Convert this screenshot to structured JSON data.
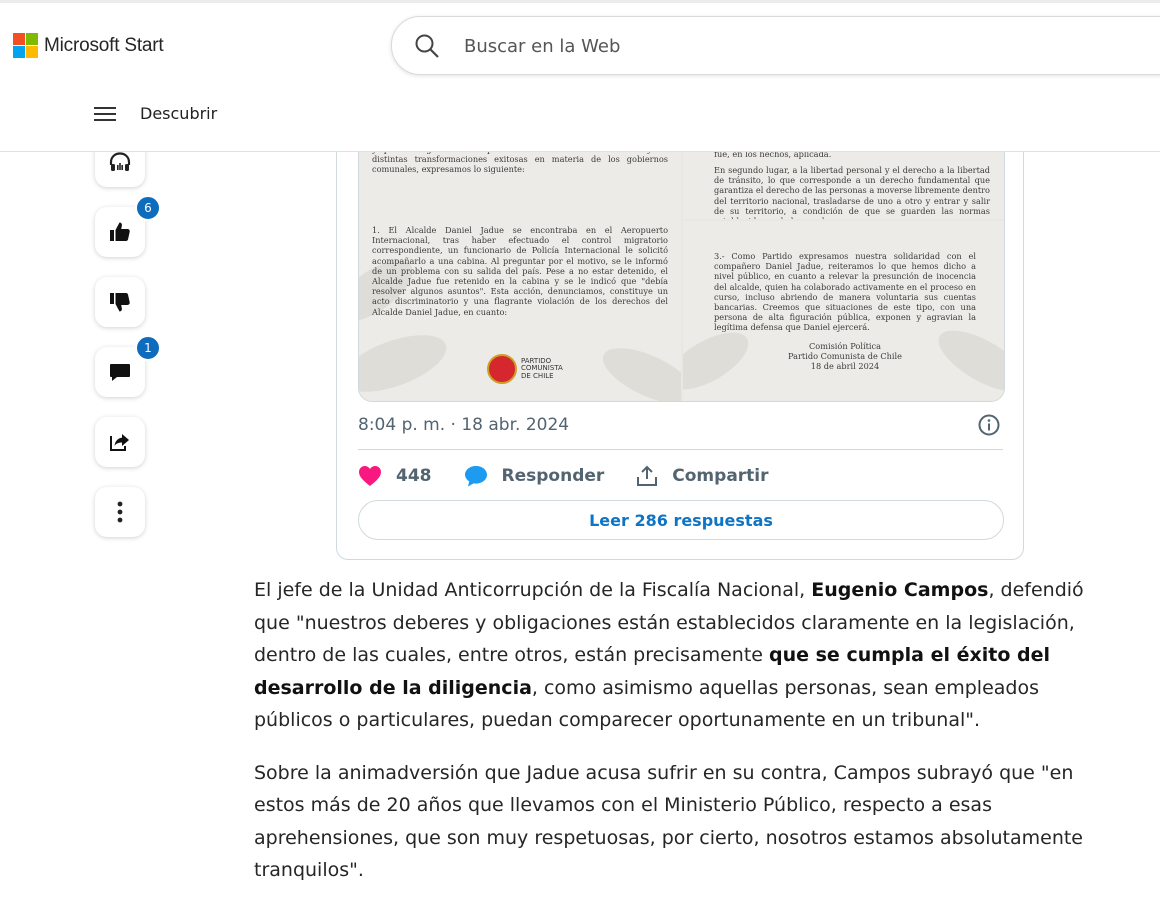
{
  "header": {
    "brand": "Microsoft Start",
    "search_placeholder": "Buscar en la Web",
    "nav_label": "Descubrir",
    "colors": {
      "ms_red": "#f25022",
      "ms_green": "#7fba00",
      "ms_blue": "#00a4ef",
      "ms_yellow": "#ffb900"
    }
  },
  "rail": {
    "buttons": [
      {
        "icon": "headphones-icon"
      },
      {
        "icon": "thumbs-up-icon",
        "badge": "6"
      },
      {
        "icon": "thumbs-down-icon"
      },
      {
        "icon": "comment-icon",
        "badge": "1"
      },
      {
        "icon": "share-icon"
      },
      {
        "icon": "more-icon"
      }
    ]
  },
  "tweet": {
    "doc_left_p1": "patente vulneración a sus derechos garantizados constitucionalmente, mientras se dirigía al \"Encuentro hacia la Agenda Alternativa Social Mundial\", invitación de la que tenía conocimiento la Comisión Política y que se origina en su experiencia como alcalde de Recoleta y las distintas transformaciones exitosas en materia de los gobiernos comunales, expresamos lo siguiente:",
    "doc_left_p2": "1. El Alcalde Daniel Jadue se encontraba en el Aeropuerto Internacional, tras haber efectuado el control migratorio correspondiente, un funcionario de Policía Internacional le solicitó acompañarlo a una cabina. Al preguntar por el motivo, se le informó de un problema con su salida del país. Pese a no estar detenido, el Alcalde Jadue fue retenido en la cabina y se le indicó que \"debía resolver algunos asuntos\". Esta acción, denunciamos, constituye un acto discriminatorio y una flagrante violación de los derechos del Alcalde Daniel Jadue, en cuanto:",
    "party_name_1": "PARTIDO",
    "party_name_2": "COMUNISTA",
    "party_name_3": "DE CHILE",
    "doc_right_top_p1": "fue, en los hechos, aplicada.",
    "doc_right_top_p2": "En segundo lugar, a la libertad personal y el derecho a la libertad de tránsito, lo que corresponde a un derecho fundamental que garantiza el derecho de las personas a moverse libremente dentro del territorio nacional, trasladarse de uno a otro y entrar y salir de su territorio, a condición de que se guarden las normas establecidas en la ley y salvo",
    "doc_right_bottom_p1": "3.- Como Partido expresamos nuestra solidaridad con el compañero Daniel Jadue, reiteramos lo que hemos dicho a nivel público, en cuanto a relevar la presunción de inocencia del alcalde, quien ha colaborado activamente en el proceso en curso, incluso abriendo de manera voluntaria sus cuentas bancarias. Creemos que situaciones de este tipo, con una persona de alta figuración pública, exponen y agravian la legítima defensa que Daniel ejercerá.",
    "sign_1": "Comisión Política",
    "sign_2": "Partido Comunista de Chile",
    "sign_3": "18 de abril 2024",
    "timestamp": "8:04 p. m. · 18 abr. 2024",
    "likes": "448",
    "reply_label": "Responder",
    "share_label": "Compartir",
    "read_replies_label": "Leer 286 respuestas",
    "colors": {
      "heart": "#f91880",
      "reply_bubble": "#1d9bf0",
      "link": "#0f74c4"
    }
  },
  "article": {
    "p1_a": "El jefe de la Unidad Anticorrupción de la Fiscalía Nacional, ",
    "p1_b": "Eugenio Campos",
    "p1_c": ", defendió que \"nuestros deberes y obligaciones están establecidos claramente en la legislación, dentro de las cuales, entre otros, están precisamente ",
    "p1_d": "que se cumpla el éxito del desarrollo de la diligencia",
    "p1_e": ", como asimismo aquellas personas, sean empleados públicos o particulares, puedan comparecer oportunamente en un tribunal\".",
    "p2": "Sobre la animadversión que Jadue acusa sufrir en su contra, Campos subrayó que \"en estos más de 20 años que llevamos con el Ministerio Público, respecto a esas aprehensiones, que son muy respetuosas, por cierto, nosotros estamos absolutamente tranquilos\"."
  }
}
